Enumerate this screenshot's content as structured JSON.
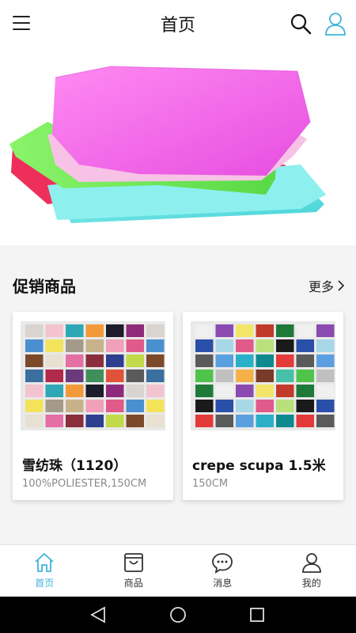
{
  "header": {
    "title": "首页"
  },
  "promo": {
    "title": "促销商品",
    "more": "更多",
    "products": [
      {
        "name": "雪纺珠（1120）",
        "desc": "100%POLIESTER,150CM"
      },
      {
        "name": "crepe scupa 1.5米",
        "desc": "150CM"
      }
    ]
  },
  "tabs": [
    {
      "label": "首页",
      "icon": "home-icon",
      "active": true
    },
    {
      "label": "商品",
      "icon": "shopping-bag-icon"
    },
    {
      "label": "消息",
      "icon": "chat-bubble-icon"
    },
    {
      "label": "我的",
      "icon": "user-icon"
    }
  ],
  "colors": {
    "accent": "#3fb4d9",
    "text": "#111111",
    "muted": "#8a8a8a",
    "background": "#f4f4f4"
  }
}
